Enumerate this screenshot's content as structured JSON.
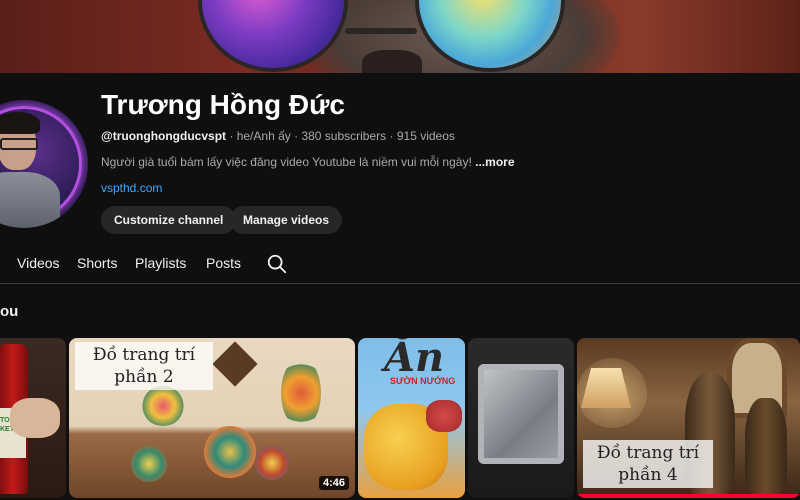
{
  "channel": {
    "name": "Trương Hồng Đức",
    "handle": "@truonghongducvspt",
    "pronouns": "he/Anh ấy",
    "subscribers": "380 subscribers",
    "videos": "915 videos",
    "separator": "·",
    "description": "Người già tuổi bám lấy việc đăng video Youtube là niềm vui mỗi ngày!",
    "more_label": "...more",
    "link": "vspthd.com"
  },
  "actions": {
    "customize_label": "Customize channel",
    "manage_label": "Manage videos"
  },
  "tabs": [
    {
      "label": "Videos"
    },
    {
      "label": "Shorts"
    },
    {
      "label": "Playlists"
    },
    {
      "label": "Posts"
    }
  ],
  "section": {
    "title": "ou"
  },
  "thumbnails": [
    {
      "label_text": "TOMATO KETCHUP"
    },
    {
      "caption": "Đồ trang trí phần 2",
      "duration": "4:46"
    },
    {
      "brand": "Ăn",
      "sub": "SƯỜN NƯỚNG"
    },
    {},
    {
      "caption": "Đồ trang trí phần 4",
      "progress": 1.0
    }
  ],
  "colors": {
    "background": "#0f0f0f",
    "link": "#3ea6ff",
    "button_bg": "#272727",
    "progress": "#ff0033"
  }
}
